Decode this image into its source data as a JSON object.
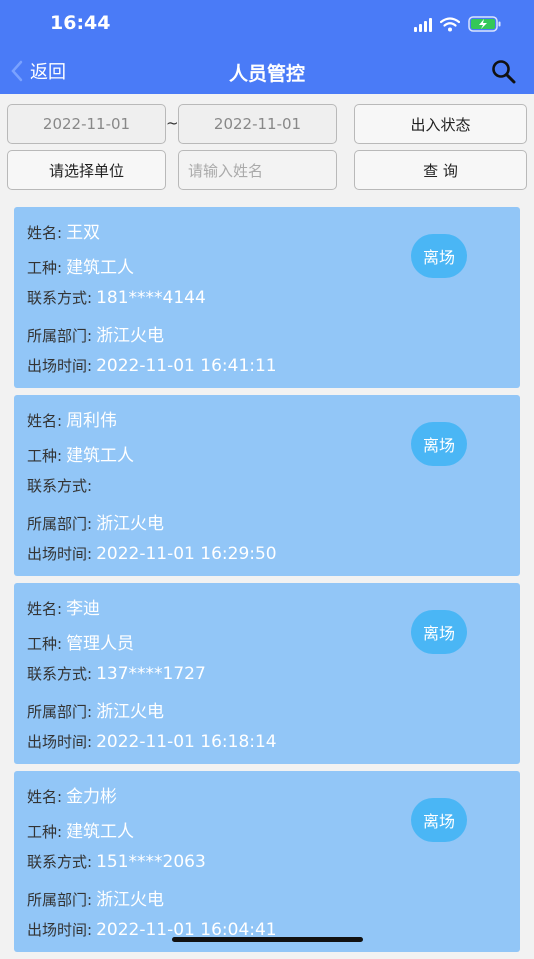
{
  "status_bar": {
    "time": "16:44"
  },
  "nav": {
    "back_label": "返回",
    "title": "人员管控"
  },
  "filters": {
    "start_date": "2022-11-01",
    "separator": "~",
    "end_date": "2022-11-01",
    "status_button": "出入状态",
    "unit_select": "请选择单位",
    "name_placeholder": "请输入姓名",
    "query_button": "查 询"
  },
  "labels": {
    "name": "姓名:",
    "job": "工种:",
    "contact": "联系方式:",
    "department": "所属部门:",
    "exit_time": "出场时间:"
  },
  "records": [
    {
      "name": "王双",
      "job": "建筑工人",
      "contact": "181****4144",
      "department": "浙江火电",
      "exit_time": "2022-11-01 16:41:11",
      "status": "离场"
    },
    {
      "name": "周利伟",
      "job": "建筑工人",
      "contact": "",
      "department": "浙江火电",
      "exit_time": "2022-11-01 16:29:50",
      "status": "离场"
    },
    {
      "name": "李迪",
      "job": "管理人员",
      "contact": "137****1727",
      "department": "浙江火电",
      "exit_time": "2022-11-01 16:18:14",
      "status": "离场"
    },
    {
      "name": "金力彬",
      "job": "建筑工人",
      "contact": "151****2063",
      "department": "浙江火电",
      "exit_time": "2022-11-01 16:04:41",
      "status": "离场"
    }
  ],
  "colors": {
    "header": "#4a7bf7",
    "card": "#92c6f7",
    "badge": "#4ab6f5"
  }
}
